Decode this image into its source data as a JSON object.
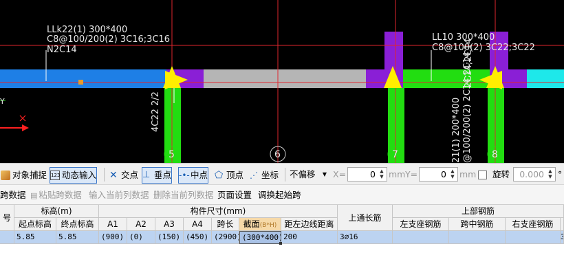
{
  "cad": {
    "annot_left": {
      "line1": "LLk22(1) 300*400",
      "line2": "C8@100/200(2) 3C16;3C16",
      "line3": "N2C14"
    },
    "annot_right": {
      "line1": "LL10 300*400",
      "line2": "C8@100(2) 3C22;3C22"
    },
    "vert_left": "4C22 2/2",
    "vert_right1": "2C14;2C14",
    "vert_right2": "21(1) 200*400",
    "vert_right3": "@100/200(2) 2C14;2C14",
    "axis_labels": [
      "5",
      "6",
      "7",
      "8"
    ],
    "axis_y_label": "Y",
    "axis_x_mark": "X",
    "colors": {
      "beam_blue": "#1e7fe6",
      "beam_gray": "#b5b5b5",
      "beam_green": "#22dd11",
      "beam_cyan": "#1ee8ea",
      "column": "#8a1fd6",
      "arrow": "#ffee00",
      "gridline": "#e0262e"
    }
  },
  "snapbar": {
    "object_snap": "对象捕捉",
    "dynamic_input": "动态输入",
    "intersection": "交点",
    "perpendicular": "垂点",
    "midpoint": "中点",
    "vertex": "顶点",
    "coordinate": "坐标",
    "offset_select": "不偏移",
    "x_label": "X=",
    "x_value": "0",
    "y_label": "Y=",
    "y_value": "0",
    "unit_mm": "mm",
    "rotate_label": "旋转",
    "rotate_value": "0.000",
    "degree": "°",
    "icons": [
      "object-snap-icon",
      "dynamic-input-icon",
      "intersection-icon",
      "perpendicular-icon",
      "midpoint-icon",
      "vertex-icon",
      "coordinate-icon",
      "dropdown-icon"
    ]
  },
  "actionbar": {
    "copy_span": "跨数据",
    "paste_span": "粘贴跨数据",
    "input_current": "输入当前列数据",
    "delete_current": "删除当前列数据",
    "page_setup": "页面设置",
    "adjust_start": "调换起始跨"
  },
  "table": {
    "h_no": "号",
    "h_elevation": "标高(m)",
    "h_component": "构件尺寸(mm)",
    "h_through": "上通长筋",
    "h_top_rebar": "上部钢筋",
    "h_start_elev": "起点标高",
    "h_end_elev": "终点标高",
    "h_a1": "A1",
    "h_a2": "A2",
    "h_a3": "A3",
    "h_a4": "A4",
    "h_span": "跨长",
    "h_section": "截面",
    "h_section_hint": "(B*H)",
    "h_left_dist": "距左边线距离",
    "h_left_support": "左支座钢筋",
    "h_mid_span": "跨中钢筋",
    "h_right_support": "右支座钢筋",
    "row": {
      "no": "",
      "start_elev": "5.85",
      "end_elev": "5.85",
      "a1": "(900)",
      "a2": "(0)",
      "a3": "(150)",
      "a4": "(450)",
      "span": "(2900)",
      "section": "(300*400)",
      "left_dist": "200",
      "through": "3⌀16",
      "left_support": "",
      "mid_span": "",
      "right_support": "",
      "tail": "3"
    }
  }
}
